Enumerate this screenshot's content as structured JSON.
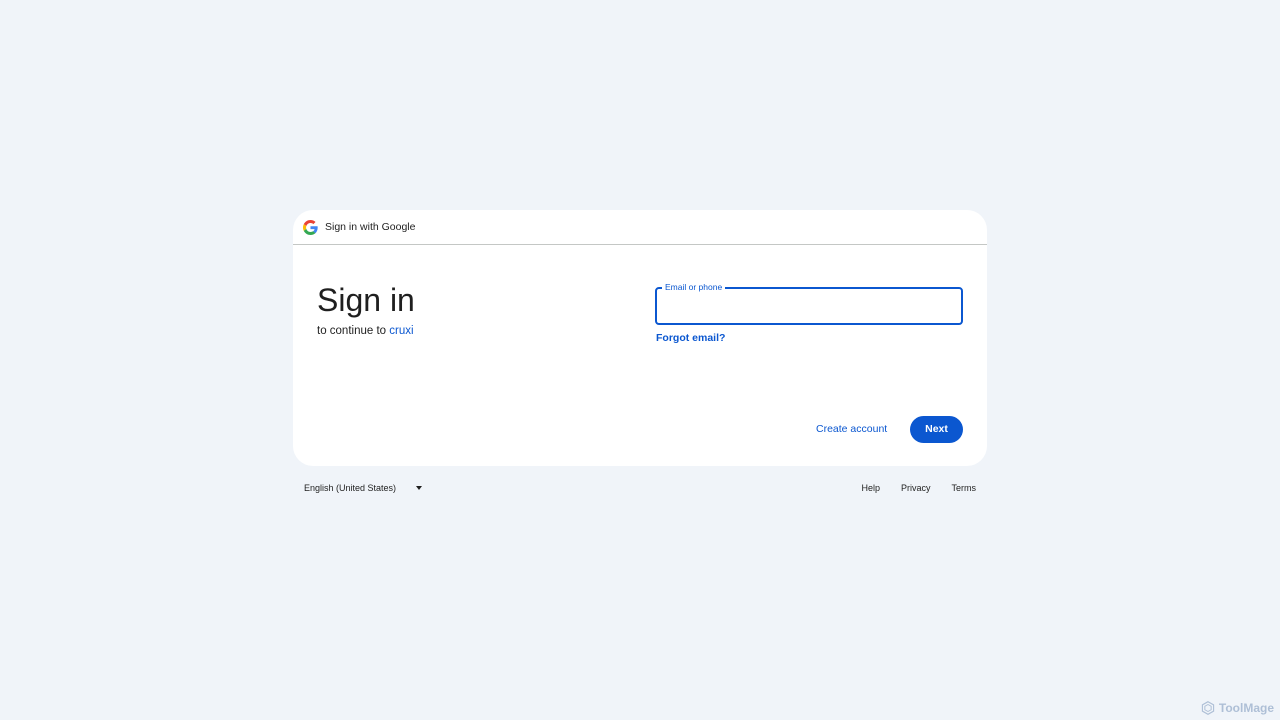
{
  "header": {
    "brand_text": "Sign in with Google",
    "logo_icon": "google-g-icon"
  },
  "main": {
    "title": "Sign in",
    "subtitle_prefix": "to continue to",
    "app_name": "cruxi"
  },
  "form": {
    "email_label": "Email or phone",
    "email_value": "",
    "forgot_label": "Forgot email?",
    "create_account_label": "Create account",
    "next_label": "Next"
  },
  "footer": {
    "language": "English (United States)",
    "links": [
      "Help",
      "Privacy",
      "Terms"
    ]
  },
  "watermark": {
    "text": "ToolMage",
    "icon": "hexagon-logo-icon"
  },
  "colors": {
    "background": "#f0f4f9",
    "accent": "#0b57d0",
    "card": "#ffffff",
    "text": "#1f1f1f"
  }
}
